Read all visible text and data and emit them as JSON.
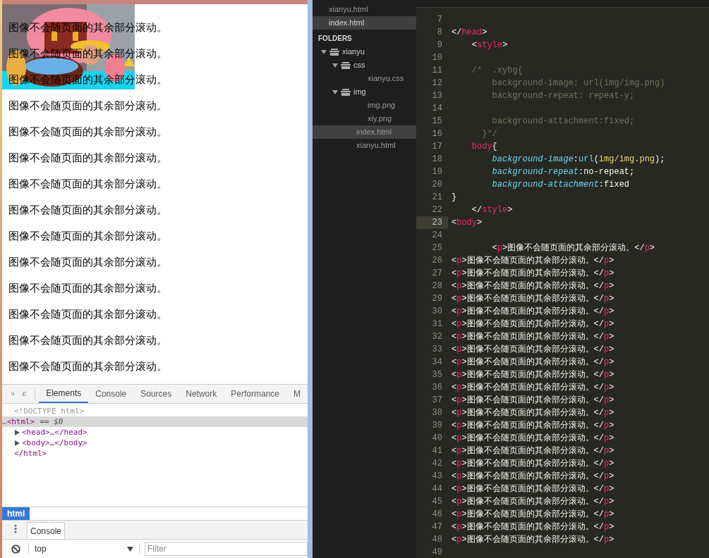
{
  "browser": {
    "paragraphs": [
      "图像不会随页面的其余部分滚动。",
      "图像不会随页面的其余部分滚动。",
      "图像不会随页面的其余部分滚动。",
      "图像不会随页面的其余部分滚动。",
      "图像不会随页面的其余部分滚动。",
      "图像不会随页面的其余部分滚动。",
      "图像不会随页面的其余部分滚动。",
      "图像不会随页面的其余部分滚动。",
      "图像不会随页面的其余部分滚动。",
      "图像不会随页面的其余部分滚动。",
      "图像不会随页面的其余部分滚动。",
      "图像不会随页面的其余部分滚动。",
      "图像不会随页面的其余部分滚动。",
      "图像不会随页面的其余部分滚动。"
    ]
  },
  "devtools": {
    "tabs": [
      {
        "label": "Elements",
        "selected": true
      },
      {
        "label": "Console",
        "selected": false
      },
      {
        "label": "Sources",
        "selected": false
      },
      {
        "label": "Network",
        "selected": false
      },
      {
        "label": "Performance",
        "selected": false
      },
      {
        "label": "M",
        "selected": false
      }
    ],
    "dom": [
      {
        "kind": "doctype",
        "text": "<!DOCTYPE html>",
        "selected": false
      },
      {
        "kind": "open",
        "dots": "…",
        "text": "<html>",
        "suffix": "== $0",
        "selected": true
      },
      {
        "kind": "collapsed",
        "text": "<head>…</head>",
        "selected": false
      },
      {
        "kind": "collapsed",
        "text": "<body>…</body>",
        "selected": false
      },
      {
        "kind": "close",
        "text": "</html>",
        "selected": false
      }
    ],
    "breadcrumb": "html",
    "drawer_tab": "Console",
    "context": "top",
    "filter_placeholder": "Filter"
  },
  "sidebar": {
    "open_files": [
      {
        "name": "xianyu.html",
        "selected": false
      },
      {
        "name": "index.html",
        "selected": true
      }
    ],
    "folders_title": "FOLDERS",
    "tree": [
      {
        "name": "xianyu",
        "kind": "folder",
        "expanded": true,
        "selected": false,
        "children": [
          {
            "name": "css",
            "kind": "folder",
            "expanded": true,
            "selected": false,
            "children": [
              {
                "name": "xianyu.css",
                "kind": "file",
                "selected": false
              }
            ]
          },
          {
            "name": "img",
            "kind": "folder",
            "expanded": true,
            "selected": false,
            "children": [
              {
                "name": "img.png",
                "kind": "file",
                "selected": false
              },
              {
                "name": "xiy.png",
                "kind": "file",
                "selected": false
              }
            ]
          },
          {
            "name": "index.html",
            "kind": "file",
            "selected": true
          },
          {
            "name": "xianyu.html",
            "kind": "file",
            "selected": false
          }
        ]
      }
    ]
  },
  "editor": {
    "lines": [
      {
        "number": "7",
        "current": false
      },
      {
        "number": "8",
        "current": false,
        "tokens": [
          {
            "kind": "plain",
            "text": "</"
          },
          {
            "kind": "tag",
            "text": "head"
          },
          {
            "kind": "plain",
            "text": ">"
          }
        ]
      },
      {
        "number": "9",
        "current": false,
        "tokens": [
          {
            "kind": "plain",
            "text": "    <"
          },
          {
            "kind": "tag",
            "text": "style"
          },
          {
            "kind": "plain",
            "text": ">"
          }
        ]
      },
      {
        "number": "10",
        "current": false
      },
      {
        "number": "11",
        "current": false,
        "tokens": [
          {
            "kind": "comment",
            "text": "    /*  .xybg{"
          }
        ]
      },
      {
        "number": "12",
        "current": false,
        "tokens": [
          {
            "kind": "comment",
            "text": "        background-image: url(img/img.png)"
          }
        ]
      },
      {
        "number": "13",
        "current": false,
        "tokens": [
          {
            "kind": "comment",
            "text": "        background-repeat: repeat-y;"
          }
        ]
      },
      {
        "number": "14",
        "current": false
      },
      {
        "number": "15",
        "current": false,
        "tokens": [
          {
            "kind": "comment",
            "text": "        background-attachment:fixed;"
          }
        ]
      },
      {
        "number": "16",
        "current": false,
        "tokens": [
          {
            "kind": "comment",
            "text": "      }*/"
          }
        ]
      },
      {
        "number": "17",
        "current": false,
        "tokens": [
          {
            "kind": "tag",
            "text": "    body"
          },
          {
            "kind": "plain",
            "text": "{"
          }
        ]
      },
      {
        "number": "18",
        "current": false,
        "tokens": [
          {
            "kind": "prop",
            "text": "        background-image"
          },
          {
            "kind": "plain",
            "text": ":"
          },
          {
            "kind": "func",
            "text": "url"
          },
          {
            "kind": "plain",
            "text": "("
          },
          {
            "kind": "string",
            "text": "img/img.png"
          },
          {
            "kind": "plain",
            "text": ");"
          }
        ]
      },
      {
        "number": "19",
        "current": false,
        "tokens": [
          {
            "kind": "prop",
            "text": "        background-repeat"
          },
          {
            "kind": "plain",
            "text": ":no-repeat;"
          }
        ]
      },
      {
        "number": "20",
        "current": false,
        "tokens": [
          {
            "kind": "prop",
            "text": "        background-attachment"
          },
          {
            "kind": "plain",
            "text": ":fixed"
          }
        ]
      },
      {
        "number": "21",
        "current": false,
        "tokens": [
          {
            "kind": "plain",
            "text": "}"
          }
        ]
      },
      {
        "number": "22",
        "current": false,
        "tokens": [
          {
            "kind": "plain",
            "text": "    </"
          },
          {
            "kind": "tag",
            "text": "style"
          },
          {
            "kind": "plain",
            "text": ">"
          }
        ]
      },
      {
        "number": "23",
        "current": true,
        "tokens": [
          {
            "kind": "plain",
            "text": "<"
          },
          {
            "kind": "tag",
            "text": "body"
          },
          {
            "kind": "plain",
            "text": ">"
          }
        ]
      },
      {
        "number": "24",
        "current": false
      },
      {
        "number": "25",
        "current": false,
        "tokens": [
          {
            "kind": "plain",
            "text": "        <"
          },
          {
            "kind": "tag",
            "text": "p"
          },
          {
            "kind": "plain",
            "text": ">图像不会随页面的其余部分滚动。</"
          },
          {
            "kind": "tag",
            "text": "p"
          },
          {
            "kind": "plain",
            "text": ">"
          }
        ]
      },
      {
        "number": "26",
        "current": false,
        "tokens": [
          {
            "kind": "plain",
            "text": "<"
          },
          {
            "kind": "tag",
            "text": "p"
          },
          {
            "kind": "plain",
            "text": ">图像不会随页面的其余部分滚动。</"
          },
          {
            "kind": "tag",
            "text": "p"
          },
          {
            "kind": "plain",
            "text": ">"
          }
        ]
      },
      {
        "number": "27",
        "current": false,
        "tokens": [
          {
            "kind": "plain",
            "text": "<"
          },
          {
            "kind": "tag",
            "text": "p"
          },
          {
            "kind": "plain",
            "text": ">图像不会随页面的其余部分滚动。</"
          },
          {
            "kind": "tag",
            "text": "p"
          },
          {
            "kind": "plain",
            "text": ">"
          }
        ]
      },
      {
        "number": "28",
        "current": false,
        "tokens": [
          {
            "kind": "plain",
            "text": "<"
          },
          {
            "kind": "tag",
            "text": "p"
          },
          {
            "kind": "plain",
            "text": ">图像不会随页面的其余部分滚动。</"
          },
          {
            "kind": "tag",
            "text": "p"
          },
          {
            "kind": "plain",
            "text": ">"
          }
        ]
      },
      {
        "number": "29",
        "current": false,
        "tokens": [
          {
            "kind": "plain",
            "text": "<"
          },
          {
            "kind": "tag",
            "text": "p"
          },
          {
            "kind": "plain",
            "text": ">图像不会随页面的其余部分滚动。</"
          },
          {
            "kind": "tag",
            "text": "p"
          },
          {
            "kind": "plain",
            "text": ">"
          }
        ]
      },
      {
        "number": "30",
        "current": false,
        "tokens": [
          {
            "kind": "plain",
            "text": "<"
          },
          {
            "kind": "tag",
            "text": "p"
          },
          {
            "kind": "plain",
            "text": ">图像不会随页面的其余部分滚动。</"
          },
          {
            "kind": "tag",
            "text": "p"
          },
          {
            "kind": "plain",
            "text": ">"
          }
        ]
      },
      {
        "number": "31",
        "current": false,
        "tokens": [
          {
            "kind": "plain",
            "text": "<"
          },
          {
            "kind": "tag",
            "text": "p"
          },
          {
            "kind": "plain",
            "text": ">图像不会随页面的其余部分滚动。</"
          },
          {
            "kind": "tag",
            "text": "p"
          },
          {
            "kind": "plain",
            "text": ">"
          }
        ]
      },
      {
        "number": "32",
        "current": false,
        "tokens": [
          {
            "kind": "plain",
            "text": "<"
          },
          {
            "kind": "tag",
            "text": "p"
          },
          {
            "kind": "plain",
            "text": ">图像不会随页面的其余部分滚动。</"
          },
          {
            "kind": "tag",
            "text": "p"
          },
          {
            "kind": "plain",
            "text": ">"
          }
        ]
      },
      {
        "number": "33",
        "current": false,
        "tokens": [
          {
            "kind": "plain",
            "text": "<"
          },
          {
            "kind": "tag",
            "text": "p"
          },
          {
            "kind": "plain",
            "text": ">图像不会随页面的其余部分滚动。</"
          },
          {
            "kind": "tag",
            "text": "p"
          },
          {
            "kind": "plain",
            "text": ">"
          }
        ]
      },
      {
        "number": "34",
        "current": false,
        "tokens": [
          {
            "kind": "plain",
            "text": "<"
          },
          {
            "kind": "tag",
            "text": "p"
          },
          {
            "kind": "plain",
            "text": ">图像不会随页面的其余部分滚动。</"
          },
          {
            "kind": "tag",
            "text": "p"
          },
          {
            "kind": "plain",
            "text": ">"
          }
        ]
      },
      {
        "number": "35",
        "current": false,
        "tokens": [
          {
            "kind": "plain",
            "text": "<"
          },
          {
            "kind": "tag",
            "text": "p"
          },
          {
            "kind": "plain",
            "text": ">图像不会随页面的其余部分滚动。</"
          },
          {
            "kind": "tag",
            "text": "p"
          },
          {
            "kind": "plain",
            "text": ">"
          }
        ]
      },
      {
        "number": "36",
        "current": false,
        "tokens": [
          {
            "kind": "plain",
            "text": "<"
          },
          {
            "kind": "tag",
            "text": "p"
          },
          {
            "kind": "plain",
            "text": ">图像不会随页面的其余部分滚动。</"
          },
          {
            "kind": "tag",
            "text": "p"
          },
          {
            "kind": "plain",
            "text": ">"
          }
        ]
      },
      {
        "number": "37",
        "current": false,
        "tokens": [
          {
            "kind": "plain",
            "text": "<"
          },
          {
            "kind": "tag",
            "text": "p"
          },
          {
            "kind": "plain",
            "text": ">图像不会随页面的其余部分滚动。</"
          },
          {
            "kind": "tag",
            "text": "p"
          },
          {
            "kind": "plain",
            "text": ">"
          }
        ]
      },
      {
        "number": "38",
        "current": false,
        "tokens": [
          {
            "kind": "plain",
            "text": "<"
          },
          {
            "kind": "tag",
            "text": "p"
          },
          {
            "kind": "plain",
            "text": ">图像不会随页面的其余部分滚动。</"
          },
          {
            "kind": "tag",
            "text": "p"
          },
          {
            "kind": "plain",
            "text": ">"
          }
        ]
      },
      {
        "number": "39",
        "current": false,
        "tokens": [
          {
            "kind": "plain",
            "text": "<"
          },
          {
            "kind": "tag",
            "text": "p"
          },
          {
            "kind": "plain",
            "text": ">图像不会随页面的其余部分滚动。</"
          },
          {
            "kind": "tag",
            "text": "p"
          },
          {
            "kind": "plain",
            "text": ">"
          }
        ]
      },
      {
        "number": "40",
        "current": false,
        "tokens": [
          {
            "kind": "plain",
            "text": "<"
          },
          {
            "kind": "tag",
            "text": "p"
          },
          {
            "kind": "plain",
            "text": ">图像不会随页面的其余部分滚动。</"
          },
          {
            "kind": "tag",
            "text": "p"
          },
          {
            "kind": "plain",
            "text": ">"
          }
        ]
      },
      {
        "number": "41",
        "current": false,
        "tokens": [
          {
            "kind": "plain",
            "text": "<"
          },
          {
            "kind": "tag",
            "text": "p"
          },
          {
            "kind": "plain",
            "text": ">图像不会随页面的其余部分滚动。</"
          },
          {
            "kind": "tag",
            "text": "p"
          },
          {
            "kind": "plain",
            "text": ">"
          }
        ]
      },
      {
        "number": "42",
        "current": false,
        "tokens": [
          {
            "kind": "plain",
            "text": "<"
          },
          {
            "kind": "tag",
            "text": "p"
          },
          {
            "kind": "plain",
            "text": ">图像不会随页面的其余部分滚动。</"
          },
          {
            "kind": "tag",
            "text": "p"
          },
          {
            "kind": "plain",
            "text": ">"
          }
        ]
      },
      {
        "number": "43",
        "current": false,
        "tokens": [
          {
            "kind": "plain",
            "text": "<"
          },
          {
            "kind": "tag",
            "text": "p"
          },
          {
            "kind": "plain",
            "text": ">图像不会随页面的其余部分滚动。</"
          },
          {
            "kind": "tag",
            "text": "p"
          },
          {
            "kind": "plain",
            "text": ">"
          }
        ]
      },
      {
        "number": "44",
        "current": false,
        "tokens": [
          {
            "kind": "plain",
            "text": "<"
          },
          {
            "kind": "tag",
            "text": "p"
          },
          {
            "kind": "plain",
            "text": ">图像不会随页面的其余部分滚动。</"
          },
          {
            "kind": "tag",
            "text": "p"
          },
          {
            "kind": "plain",
            "text": ">"
          }
        ]
      },
      {
        "number": "45",
        "current": false,
        "tokens": [
          {
            "kind": "plain",
            "text": "<"
          },
          {
            "kind": "tag",
            "text": "p"
          },
          {
            "kind": "plain",
            "text": ">图像不会随页面的其余部分滚动。</"
          },
          {
            "kind": "tag",
            "text": "p"
          },
          {
            "kind": "plain",
            "text": ">"
          }
        ]
      },
      {
        "number": "46",
        "current": false,
        "tokens": [
          {
            "kind": "plain",
            "text": "<"
          },
          {
            "kind": "tag",
            "text": "p"
          },
          {
            "kind": "plain",
            "text": ">图像不会随页面的其余部分滚动。</"
          },
          {
            "kind": "tag",
            "text": "p"
          },
          {
            "kind": "plain",
            "text": ">"
          }
        ]
      },
      {
        "number": "47",
        "current": false,
        "tokens": [
          {
            "kind": "plain",
            "text": "<"
          },
          {
            "kind": "tag",
            "text": "p"
          },
          {
            "kind": "plain",
            "text": ">图像不会随页面的其余部分滚动。</"
          },
          {
            "kind": "tag",
            "text": "p"
          },
          {
            "kind": "plain",
            "text": ">"
          }
        ]
      },
      {
        "number": "48",
        "current": false,
        "tokens": [
          {
            "kind": "plain",
            "text": "<"
          },
          {
            "kind": "tag",
            "text": "p"
          },
          {
            "kind": "plain",
            "text": ">图像不会随页面的其余部分滚动。</"
          },
          {
            "kind": "tag",
            "text": "p"
          },
          {
            "kind": "plain",
            "text": ">"
          }
        ]
      },
      {
        "number": "49",
        "current": false
      }
    ]
  }
}
